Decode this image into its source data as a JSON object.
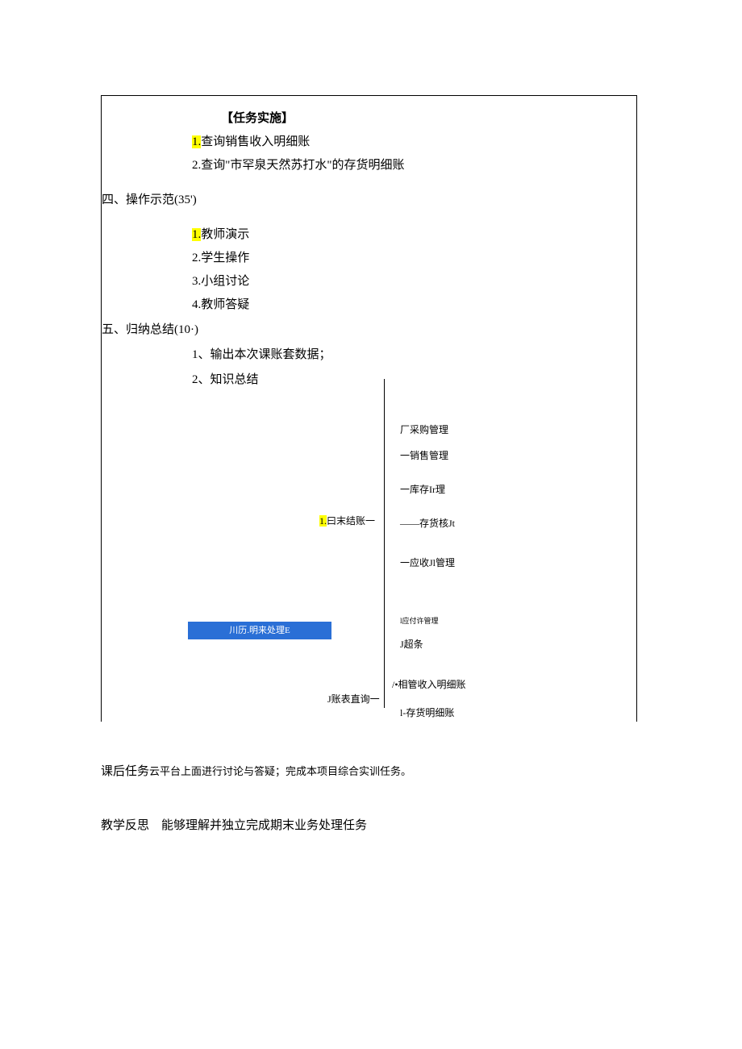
{
  "task_header": "【任务实施】",
  "task1_num": "1.",
  "task1_text": "查询销售收入明细账",
  "task2": "2.查询\"市罕泉天然苏打水\"的存货明细账",
  "section4": "四、操作示范(35')",
  "op1_num": "1.",
  "op1_text": "教师演示",
  "op2": "2.学生操作",
  "op3": "3.小组讨论",
  "op4": "4.教师答疑",
  "section5": "五、归纳总结(10·)",
  "sum1": "1、输出本次课账套数据；",
  "sum2": "2、知识总结",
  "diagram": {
    "n_caigou": "厂采购管理",
    "n_xiaoshou": "一销售管理",
    "n_kucun": "一库存Ir理",
    "n_jiezhang_num": "1.",
    "n_jiezhang_text": "曰末结账一",
    "n_cunhuohe": "——存货核Jt",
    "n_yingshou": "一应收Jl管理",
    "n_blue": "川历.明来处理E",
    "n_yingfu": "l应付许管理",
    "n_chaotiao": "J超条",
    "n_zhangbiao": "J账表直询一",
    "n_xiangguan": "/•相管收入明细账",
    "n_cunhuomx": "l-存货明细账"
  },
  "footer": {
    "khrw_label": "课后任务",
    "khrw_text": "云平台上面进行讨论与答疑；完成本项目综合实训任务。",
    "jxfs_label": "教学反思",
    "jxfs_text": "能够理解并独立完成期末业务处理任务"
  }
}
